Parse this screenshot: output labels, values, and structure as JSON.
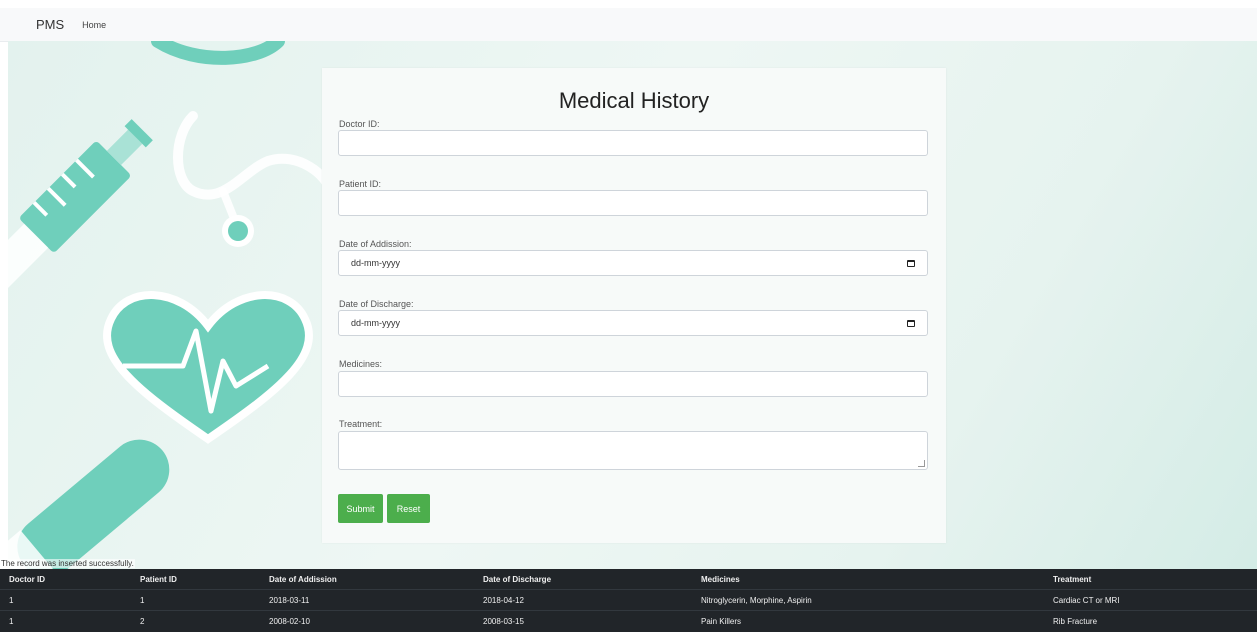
{
  "navbar": {
    "brand": "PMS",
    "links": [
      "Home"
    ]
  },
  "form": {
    "title": "Medical History",
    "fields": {
      "doctor_id": {
        "label": "Doctor ID:",
        "value": ""
      },
      "patient_id": {
        "label": "Patient ID:",
        "value": ""
      },
      "date_admission": {
        "label": "Date of Addission:",
        "placeholder": "dd-mm-yyyy"
      },
      "date_discharge": {
        "label": "Date of Discharge:",
        "placeholder": "dd-mm-yyyy"
      },
      "medicines": {
        "label": "Medicines:",
        "value": ""
      },
      "treatment": {
        "label": "Treatment:",
        "value": ""
      }
    },
    "buttons": {
      "submit": "Submit",
      "reset": "Reset"
    }
  },
  "status_message": "The record was inserted successfully.",
  "table": {
    "headers": [
      "Doctor ID",
      "Patient ID",
      "Date of Addission",
      "Date of Discharge",
      "Medicines",
      "Treatment"
    ],
    "rows": [
      [
        "1",
        "1",
        "2018-03-11",
        "2018-04-12",
        "Nitroglycerin, Morphine, Aspirin",
        "Cardiac CT or MRI"
      ],
      [
        "1",
        "2",
        "2008-02-10",
        "2008-03-15",
        "Pain Killers",
        "Rib Fracture"
      ]
    ]
  },
  "colors": {
    "primary_button": "#4cae4c",
    "table_background": "#212529",
    "decor_teal": "#69cdb9"
  }
}
